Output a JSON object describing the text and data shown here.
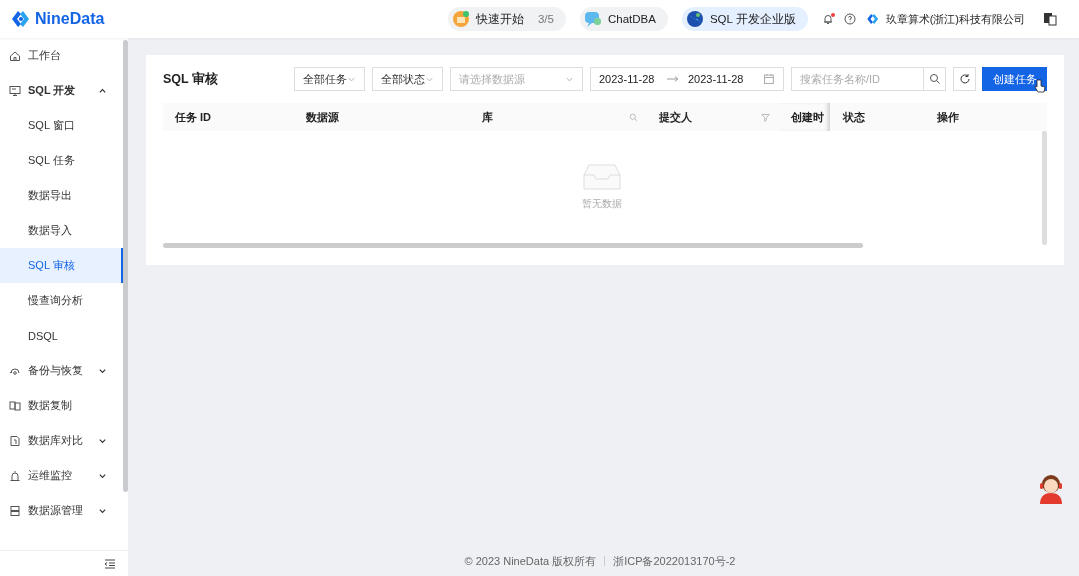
{
  "header": {
    "logo": "NineData",
    "quick_start": {
      "label": "快速开始",
      "progress": "3/5"
    },
    "chat": {
      "label": "ChatDBA"
    },
    "edition": {
      "label": "SQL 开发企业版"
    },
    "notifications": {
      "unread": true
    },
    "org": {
      "name": "玖章算术(浙江)科技有限公司"
    }
  },
  "sidebar": {
    "items": [
      {
        "label": "工作台",
        "selected": false
      },
      {
        "label": "SQL 开发",
        "selected": false,
        "expanded": true,
        "children": [
          {
            "label": "SQL 窗口",
            "selected": false
          },
          {
            "label": "SQL 任务",
            "selected": false
          },
          {
            "label": "数据导出",
            "selected": false
          },
          {
            "label": "数据导入",
            "selected": false
          },
          {
            "label": "SQL 审核",
            "selected": true
          },
          {
            "label": "慢查询分析",
            "selected": false
          },
          {
            "label": "DSQL",
            "selected": false
          }
        ]
      },
      {
        "label": "备份与恢复",
        "selected": false,
        "expanded": false
      },
      {
        "label": "数据复制",
        "selected": false
      },
      {
        "label": "数据库对比",
        "selected": false,
        "expanded": false
      },
      {
        "label": "运维监控",
        "selected": false,
        "expanded": false
      },
      {
        "label": "数据源管理",
        "selected": false,
        "expanded": false
      }
    ]
  },
  "page": {
    "title": "SQL 审核",
    "filters": {
      "task_type": "全部任务",
      "status": "全部状态",
      "datasource_placeholder": "请选择数据源",
      "date_from": "2023-11-28",
      "date_to": "2023-11-28",
      "search_placeholder": "搜索任务名称/ID"
    },
    "create_button": "创建任务",
    "table": {
      "columns": [
        {
          "label": "任务 ID",
          "kind": "plain"
        },
        {
          "label": "数据源",
          "kind": "plain"
        },
        {
          "label": "库",
          "kind": "search"
        },
        {
          "label": "提交人",
          "kind": "filter"
        },
        {
          "label": "创建时",
          "kind": "plain"
        },
        {
          "label": "状态",
          "kind": "plain"
        },
        {
          "label": "操作",
          "kind": "plain"
        }
      ],
      "empty_text": "暂无数据"
    }
  },
  "footer": {
    "copyright": "© 2023 NineData 版权所有",
    "icp": "浙ICP备2022013170号-2"
  }
}
